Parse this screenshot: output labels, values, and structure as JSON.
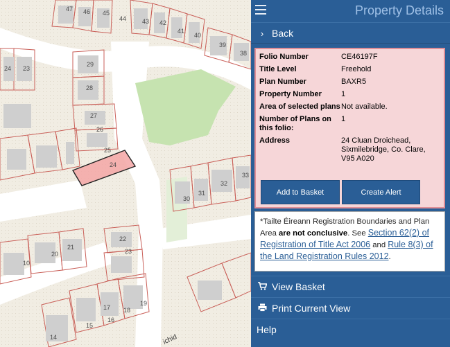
{
  "panel": {
    "title": "Property Details",
    "back_label": "Back",
    "info": [
      {
        "label": "Folio Number",
        "value": "CE46197F"
      },
      {
        "label": "Title Level",
        "value": "Freehold"
      },
      {
        "label": "Plan Number",
        "value": "BAXR5"
      },
      {
        "label": "Property Number",
        "value": "1"
      },
      {
        "label": "Area of selected plans",
        "value": "Not available."
      },
      {
        "label": "Number of Plans on this folio:",
        "value": "1"
      },
      {
        "label": "Address",
        "value": "24 Cluan Droichead, Sixmilebridge, Co. Clare, V95 A020"
      }
    ],
    "add_to_basket_label": "Add to Basket",
    "create_alert_label": "Create Alert",
    "disclaimer": {
      "intro": "*Tailte Éireann Registration Boundaries and Plan Area ",
      "bold": "are not conclusive",
      "mid": ". See ",
      "link1": "Section 62(2) of Registration of Title Act 2006",
      "and": " and ",
      "link2": "Rule 8(3) of the Land Registration Rules 2012",
      "end": "."
    },
    "view_basket_label": "View Basket",
    "print_view_label": "Print Current View",
    "help_label": "Help"
  },
  "map": {
    "plot_numbers": [
      "47",
      "46",
      "45",
      "44",
      "43",
      "42",
      "41",
      "40",
      "39",
      "38",
      "24",
      "23",
      "29",
      "28",
      "27",
      "26",
      "25",
      "24",
      "32",
      "33",
      "30",
      "31",
      "22",
      "23",
      "21",
      "20",
      "10",
      "15",
      "16",
      "17",
      "18",
      "19",
      "14"
    ],
    "road_label": "ichid",
    "selected_color": "#f4a6a6"
  },
  "colors": {
    "panel_bg": "#2a5e96",
    "info_bg": "#f6d6d8",
    "info_border": "#e08f97"
  }
}
